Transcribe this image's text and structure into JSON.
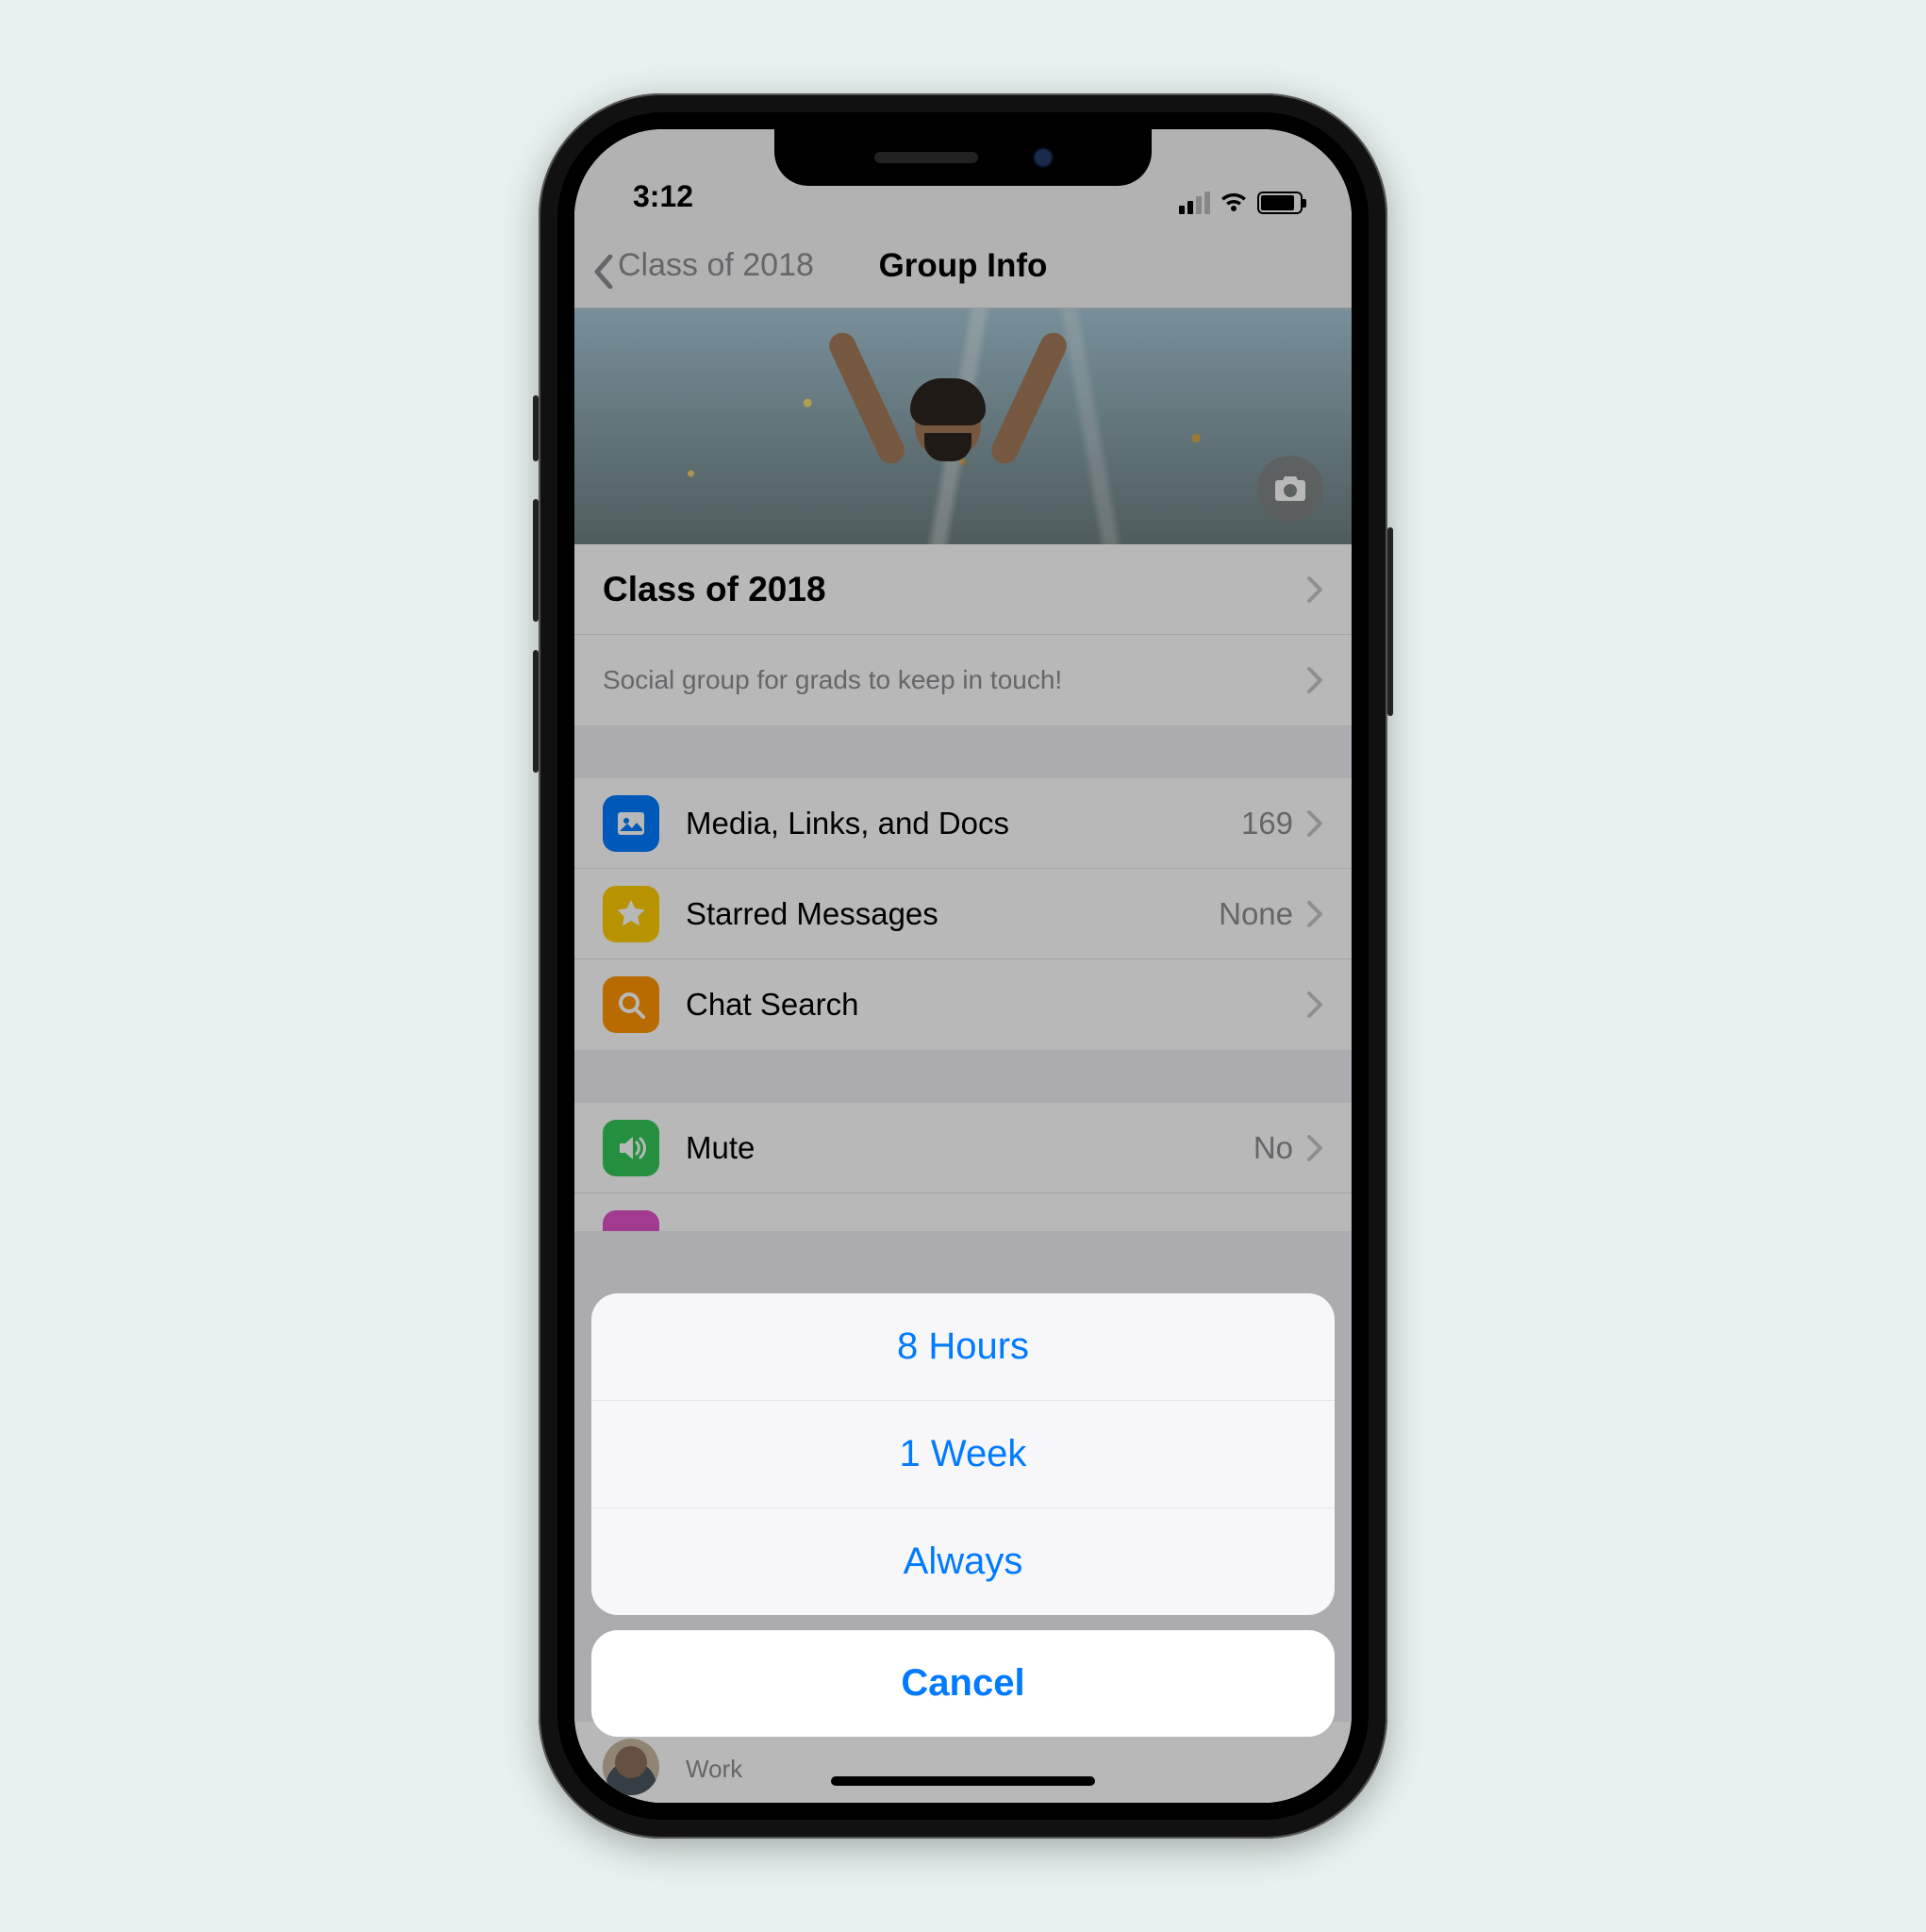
{
  "status": {
    "time": "3:12"
  },
  "nav": {
    "back_label": "Class of 2018",
    "title": "Group Info"
  },
  "group": {
    "name": "Class of 2018",
    "description": "Social group for grads to keep in touch!"
  },
  "rows": {
    "media": {
      "label": "Media, Links, and Docs",
      "value": "169"
    },
    "starred": {
      "label": "Starred Messages",
      "value": "None"
    },
    "search": {
      "label": "Chat Search"
    },
    "mute": {
      "label": "Mute",
      "value": "No"
    }
  },
  "participant": {
    "name": "",
    "sub": "Work"
  },
  "sheet": {
    "options": {
      "o1": "8 Hours",
      "o2": "1 Week",
      "o3": "Always"
    },
    "cancel": "Cancel"
  }
}
